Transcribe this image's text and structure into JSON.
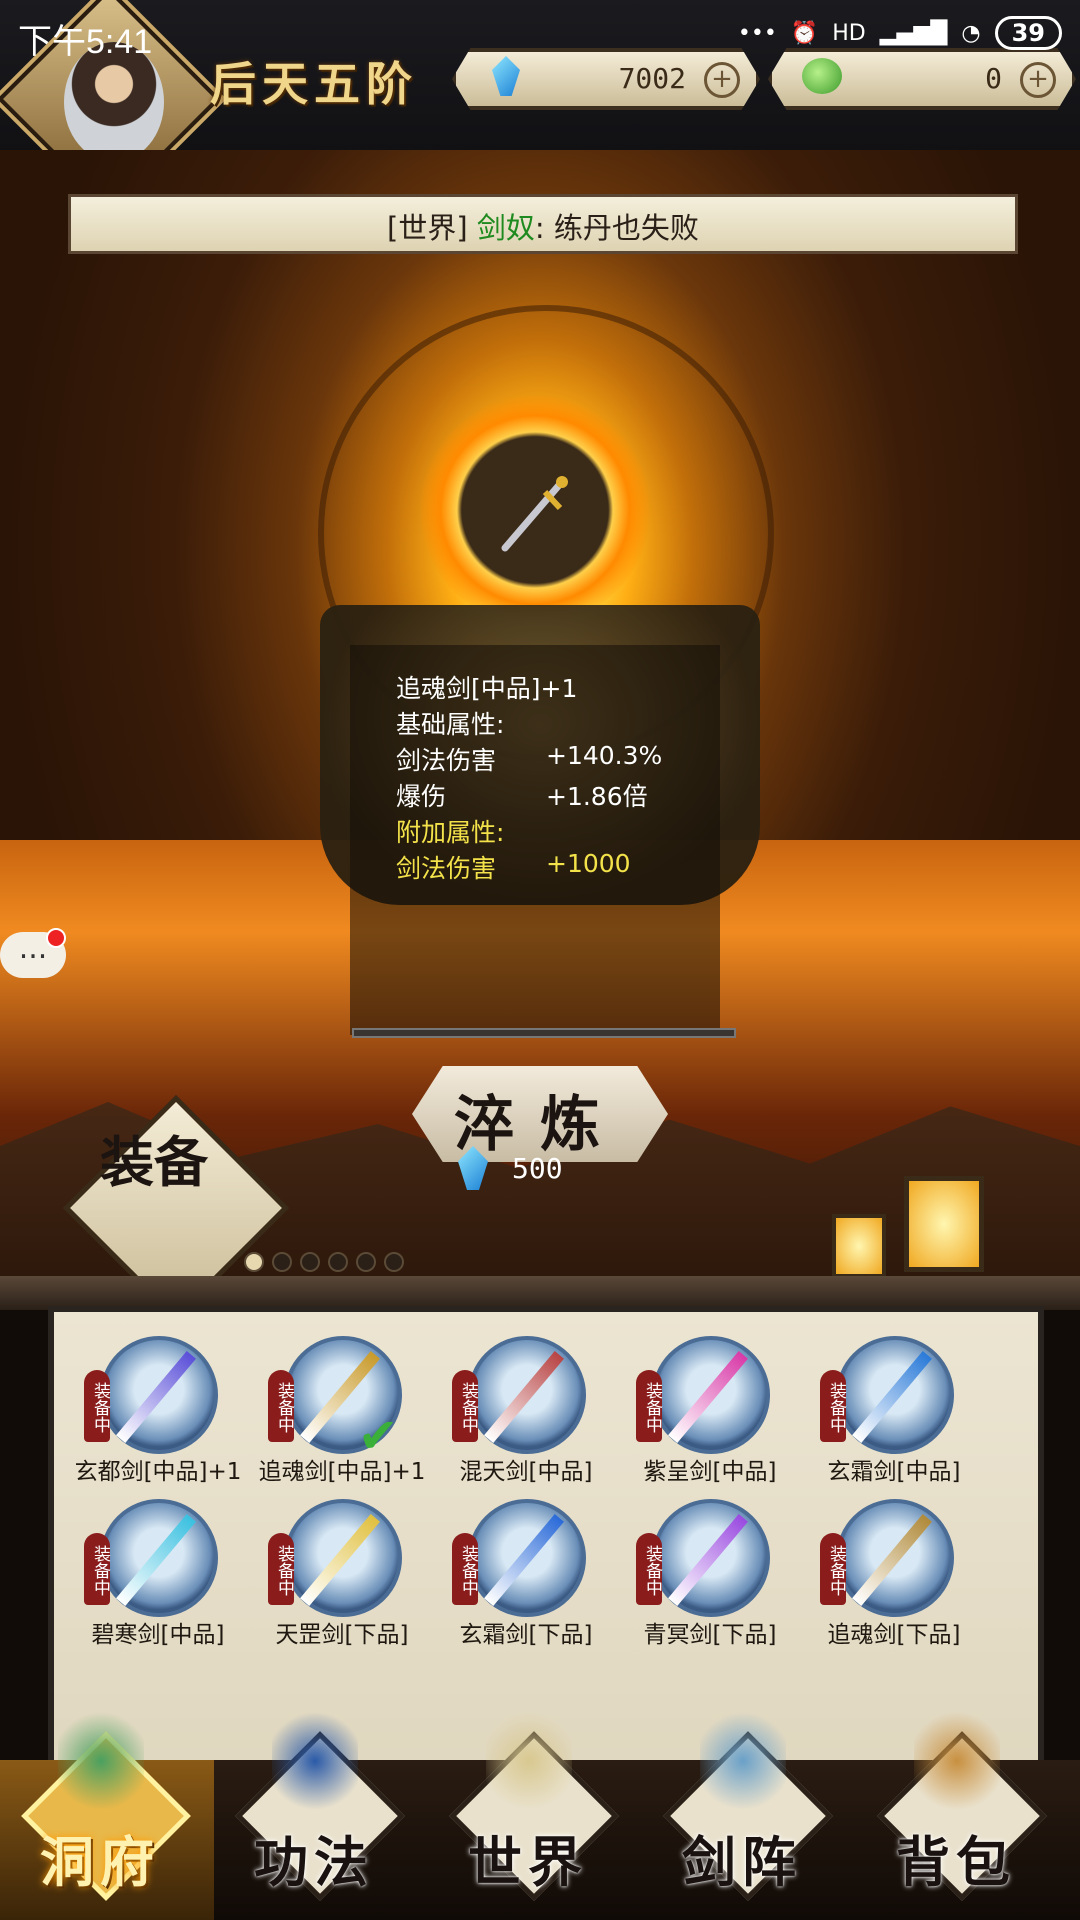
{
  "status_bar": {
    "time": "下午5:41",
    "indicators": "HD",
    "battery": "39"
  },
  "header": {
    "realm": "后天五阶",
    "crystal_count": "7002",
    "jade_count": "0",
    "plus_symbol": "+"
  },
  "chat": {
    "channel": "[世界]",
    "sender": "剑奴",
    "separator": ":",
    "message": "练丹也失败"
  },
  "selected_item": {
    "title": "追魂剑[中品]+1",
    "base_label": "基础属性:",
    "base_stats": [
      {
        "name": "剑法伤害",
        "value": "+140.3%"
      },
      {
        "name": "爆伤",
        "value": "+1.86倍"
      }
    ],
    "extra_label": "附加属性:",
    "extra_stats": [
      {
        "name": "剑法伤害",
        "value": "+1000"
      }
    ]
  },
  "refine": {
    "label": "淬炼",
    "cost": "500"
  },
  "equip_tab": {
    "label": "装备"
  },
  "chat_bubble": {
    "text": "..."
  },
  "equipment": [
    {
      "name": "玄都剑[中品]+1",
      "tag": "装备中",
      "color": "#5a4fd8"
    },
    {
      "name": "追魂剑[中品]+1",
      "tag": "装备中",
      "color": "#c89a2a"
    },
    {
      "name": "混天剑[中品]",
      "tag": "装备中",
      "color": "#b84444"
    },
    {
      "name": "紫呈剑[中品]",
      "tag": "装备中",
      "color": "#d83aa8"
    },
    {
      "name": "玄霜剑[中品]",
      "tag": "装备中",
      "color": "#2a7ad8"
    },
    {
      "name": "碧寒剑[中品]",
      "tag": "装备中",
      "color": "#3ac0e0"
    },
    {
      "name": "天罡剑[下品]",
      "tag": "装备中",
      "color": "#e0c040"
    },
    {
      "name": "玄霜剑[下品]",
      "tag": "装备中",
      "color": "#2a6ad8"
    },
    {
      "name": "青冥剑[下品]",
      "tag": "装备中",
      "color": "#9a4ae0"
    },
    {
      "name": "追魂剑[下品]",
      "tag": "装备中",
      "color": "#b08a3a"
    }
  ],
  "nav": [
    {
      "label": "洞府",
      "icon": "cave-dwelling-icon",
      "active": true
    },
    {
      "label": "功法",
      "icon": "technique-book-icon",
      "active": false
    },
    {
      "label": "世界",
      "icon": "world-scroll-icon",
      "active": false
    },
    {
      "label": "剑阵",
      "icon": "sword-array-icon",
      "active": false
    },
    {
      "label": "背包",
      "icon": "backpack-icon",
      "active": false
    }
  ]
}
